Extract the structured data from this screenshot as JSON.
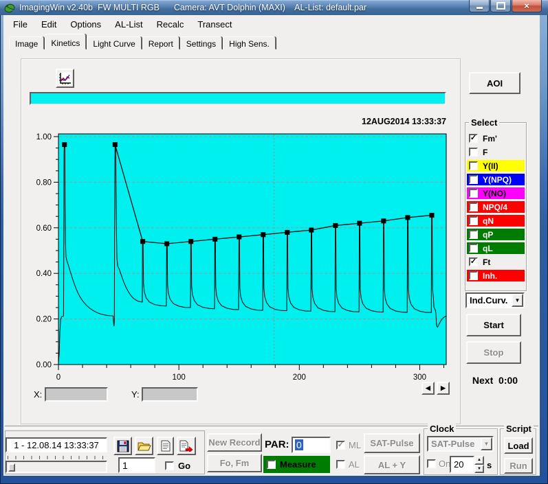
{
  "window": {
    "title": "ImagingWin v2.40b  FW MULTI RGB      Camera: AVT Dolphin (MAXI)    AL-List: default.par"
  },
  "menu": {
    "items": [
      "File",
      "Edit",
      "Options",
      "AL-List",
      "Recalc",
      "Transect"
    ]
  },
  "tabs": {
    "items": [
      "Image",
      "Kinetics",
      "Light Curve",
      "Report",
      "Settings",
      "High Sens."
    ],
    "active": "Kinetics"
  },
  "toolbar": {
    "aoi": "AOI"
  },
  "chart_header": {
    "timestamp": "12AUG2014  13:33:37"
  },
  "select_panel": {
    "title": "Select",
    "items": [
      {
        "label": "Fm'",
        "checked": true,
        "bg": "",
        "fg": "#000000"
      },
      {
        "label": "F",
        "checked": false,
        "bg": "",
        "fg": "#000000"
      },
      {
        "label": "Y(II)",
        "checked": false,
        "bg": "#ffff00",
        "fg": "#000000"
      },
      {
        "label": "Y(NPQ)",
        "checked": false,
        "bg": "#0000ff",
        "fg": "#ffffff"
      },
      {
        "label": "Y(NO)",
        "checked": false,
        "bg": "#ff00ff",
        "fg": "#000000"
      },
      {
        "label": "NPQ/4",
        "checked": false,
        "bg": "#ff0000",
        "fg": "#ffffff"
      },
      {
        "label": "qN",
        "checked": false,
        "bg": "#ff0000",
        "fg": "#ffffff"
      },
      {
        "label": "qP",
        "checked": false,
        "bg": "#007d00",
        "fg": "#ffffff"
      },
      {
        "label": "qL",
        "checked": false,
        "bg": "#007d00",
        "fg": "#ffffff"
      },
      {
        "label": "Ft",
        "checked": true,
        "bg": "",
        "fg": "#000000"
      },
      {
        "label": "Inh.",
        "checked": false,
        "bg": "#ff0000",
        "fg": "#ffffff"
      }
    ]
  },
  "run_controls": {
    "mode": "Ind.Curv.",
    "start": "Start",
    "stop": "Stop",
    "next_label": "Next",
    "next_value": "0:00"
  },
  "readout": {
    "x": "X:",
    "y": "Y:"
  },
  "record_bar": {
    "record": "1 - 12.08.14 13:33:37",
    "page": "1",
    "go": "Go"
  },
  "acquisition": {
    "new_record": "New Record",
    "fo_fm": "Fo, Fm",
    "par_label": "PAR:",
    "par_value": "0",
    "ml": "ML",
    "al": "AL",
    "measure": "Measure",
    "sat_pulse": "SAT-Pulse",
    "al_y": "AL + Y"
  },
  "clock": {
    "title": "Clock",
    "mode": "SAT-Pulse",
    "on": "On",
    "interval": "20",
    "unit": "s"
  },
  "script": {
    "title": "Script",
    "load": "Load",
    "run": "Run"
  },
  "progress": {
    "fill_percent": 100
  },
  "colors": {
    "accent_cyan": "#00efef",
    "frame_blue": "#2d5f9f",
    "selection_blue": "#2f62c4",
    "select_yellow": "#ffff00",
    "select_blue": "#0000ff",
    "select_magenta": "#ff00ff",
    "select_red": "#ff0000",
    "select_green": "#007d00"
  },
  "icons": {
    "checkmark": "✓",
    "dropdown": "▼",
    "prev": "◀",
    "next": "▶",
    "spin_up": "▲",
    "spin_down": "▼",
    "close": "×"
  },
  "chart_data": {
    "type": "line",
    "title": "",
    "xlabel": "",
    "ylabel": "",
    "xlim": [
      0,
      322
    ],
    "ylim": [
      0,
      1.0
    ],
    "x_ticks": [
      0,
      100,
      200,
      300
    ],
    "x_minor_step": 20,
    "y_ticks": [
      0.0,
      0.2,
      0.4,
      0.6,
      0.8,
      1.0
    ],
    "y_minor_step": 0.05,
    "grid_y_dashed": [
      0.2,
      0.4,
      0.6,
      0.8,
      1.0
    ],
    "cursor_x": 179,
    "background": "#00efef",
    "legend_position": "none",
    "series": [
      {
        "name": "Fm'",
        "type": "scatter-line",
        "marker": "square",
        "color": "#000000",
        "connect_from_index": 1,
        "x": [
          5,
          47,
          70,
          90,
          110,
          130,
          150,
          170,
          190,
          210,
          230,
          250,
          270,
          290,
          310
        ],
        "y": [
          0.965,
          0.965,
          0.54,
          0.53,
          0.54,
          0.55,
          0.56,
          0.57,
          0.58,
          0.59,
          0.61,
          0.62,
          0.63,
          0.645,
          0.655
        ]
      },
      {
        "name": "Ft",
        "type": "line",
        "color": "#000000",
        "intro": [
          [
            0,
            0.005
          ],
          [
            0.6,
            0.05
          ],
          [
            1.2,
            0.145
          ],
          [
            1.8,
            0.198
          ],
          [
            2.6,
            0.21
          ],
          [
            4.2,
            0.212
          ],
          [
            4.45,
            0.5
          ],
          [
            4.65,
            0.92
          ],
          [
            4.85,
            0.965
          ],
          [
            5.35,
            0.965
          ],
          [
            5.55,
            0.7
          ],
          [
            5.9,
            0.53
          ],
          [
            6.3,
            0.473
          ],
          [
            7,
            0.455
          ],
          [
            8.5,
            0.432
          ],
          [
            10,
            0.405
          ],
          [
            12,
            0.372
          ],
          [
            14,
            0.342
          ],
          [
            16,
            0.316
          ],
          [
            18,
            0.296
          ],
          [
            20,
            0.28
          ],
          [
            23,
            0.261
          ],
          [
            26,
            0.247
          ],
          [
            29,
            0.236
          ],
          [
            32,
            0.228
          ],
          [
            35,
            0.222
          ],
          [
            38,
            0.218
          ],
          [
            41,
            0.215
          ],
          [
            44,
            0.214
          ],
          [
            45.4,
            0.213
          ],
          [
            45.7,
            0.19
          ],
          [
            46.1,
            0.168
          ],
          [
            46.4,
            0.185
          ],
          [
            46.6,
            0.52
          ],
          [
            46.85,
            0.9
          ],
          [
            47.05,
            0.965
          ],
          [
            47.55,
            0.965
          ],
          [
            47.85,
            0.76
          ],
          [
            48.2,
            0.58
          ],
          [
            48.6,
            0.465
          ],
          [
            49.2,
            0.432
          ],
          [
            50.5,
            0.418
          ],
          [
            52,
            0.395
          ],
          [
            54,
            0.365
          ],
          [
            56,
            0.34
          ],
          [
            58,
            0.32
          ],
          [
            60,
            0.304
          ],
          [
            62,
            0.292
          ],
          [
            64,
            0.284
          ],
          [
            66,
            0.278
          ],
          [
            68,
            0.2755
          ],
          [
            69.3,
            0.2745
          ]
        ],
        "pulse_pre": [
          0.274,
          0.257,
          0.25,
          0.245,
          0.241,
          0.238,
          0.236,
          0.234,
          0.232,
          0.231,
          0.23,
          0.229,
          0.228
        ],
        "pulse_post": [
          0.257,
          0.25,
          0.245,
          0.241,
          0.238,
          0.236,
          0.234,
          0.232,
          0.231,
          0.23,
          0.229,
          0.228,
          0.232
        ],
        "tail": [
          [
            311.8,
            0.252
          ],
          [
            312.6,
            0.243
          ],
          [
            313.2,
            0.235
          ],
          [
            313.5,
            0.218
          ],
          [
            313.8,
            0.185
          ],
          [
            314.2,
            0.168
          ],
          [
            314.7,
            0.164
          ],
          [
            315.3,
            0.169
          ],
          [
            316.2,
            0.179
          ],
          [
            317.3,
            0.19
          ],
          [
            318.5,
            0.199
          ],
          [
            320,
            0.207
          ],
          [
            321.2,
            0.211
          ],
          [
            322,
            0.213
          ]
        ]
      }
    ]
  }
}
